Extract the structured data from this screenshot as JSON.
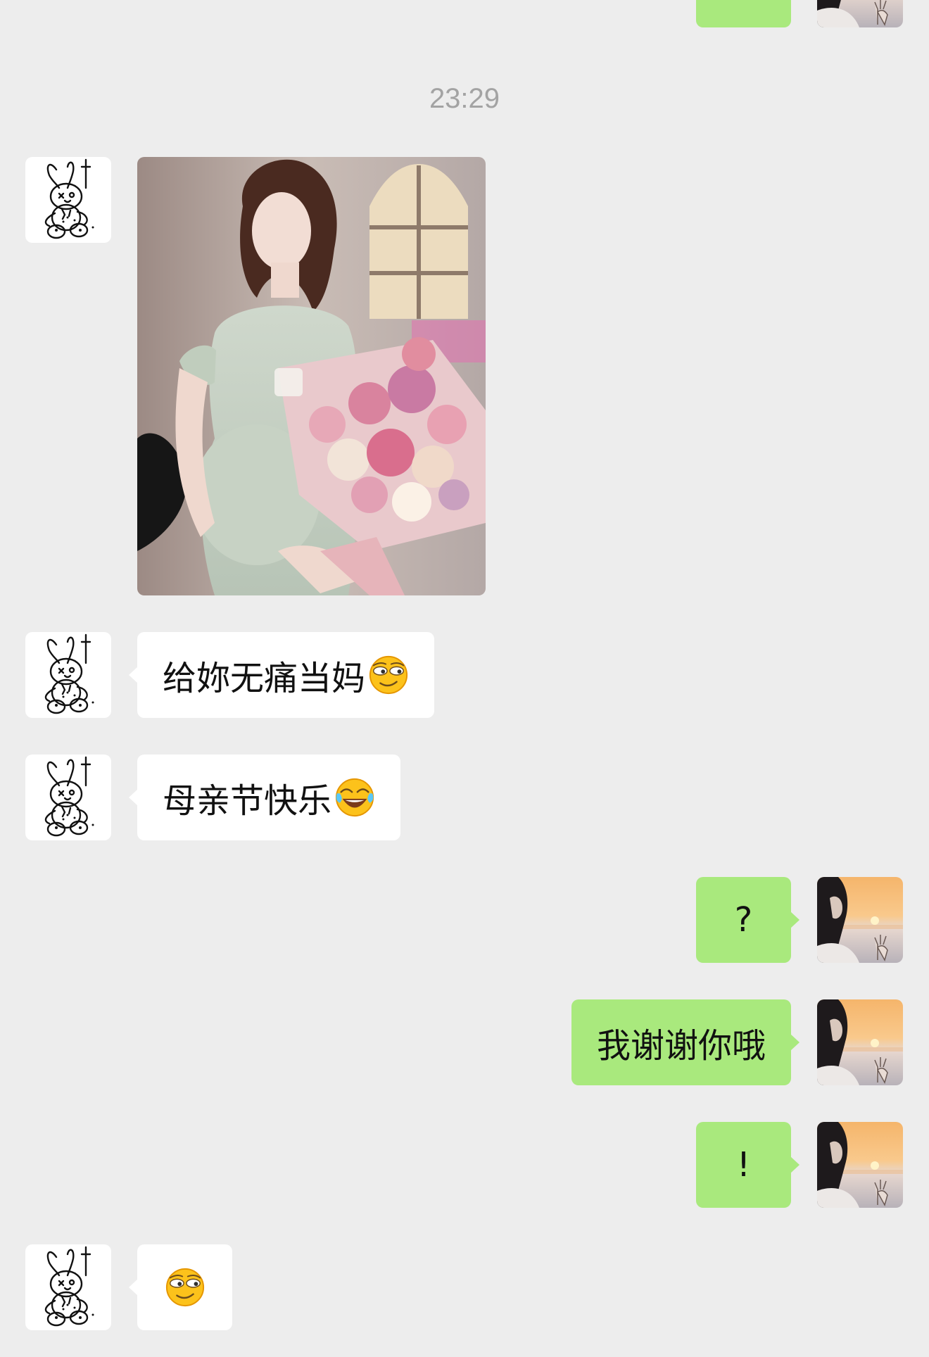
{
  "chat": {
    "timestamp": "23:29",
    "messages": [
      {
        "sender": "other",
        "type": "image",
        "content": "photo"
      },
      {
        "sender": "other",
        "type": "text",
        "text": "给妳无痛当妈",
        "emoji": "smirk-emoji"
      },
      {
        "sender": "other",
        "type": "text",
        "text": "母亲节快乐",
        "emoji": "laughing-tears-emoji"
      },
      {
        "sender": "me",
        "type": "text",
        "text": "?"
      },
      {
        "sender": "me",
        "type": "text",
        "text": "我谢谢你哦"
      },
      {
        "sender": "me",
        "type": "text",
        "text": "!"
      },
      {
        "sender": "other",
        "type": "text",
        "text": "",
        "emoji": "smirk-emoji"
      }
    ]
  },
  "colors": {
    "background": "#ededed",
    "incoming_bubble": "#ffffff",
    "outgoing_bubble": "#a9e97d",
    "timestamp_text": "#a3a3a3"
  },
  "icons": {
    "other_avatar": "sketch-bunny-avatar",
    "my_avatar": "sunset-girl-avatar"
  }
}
